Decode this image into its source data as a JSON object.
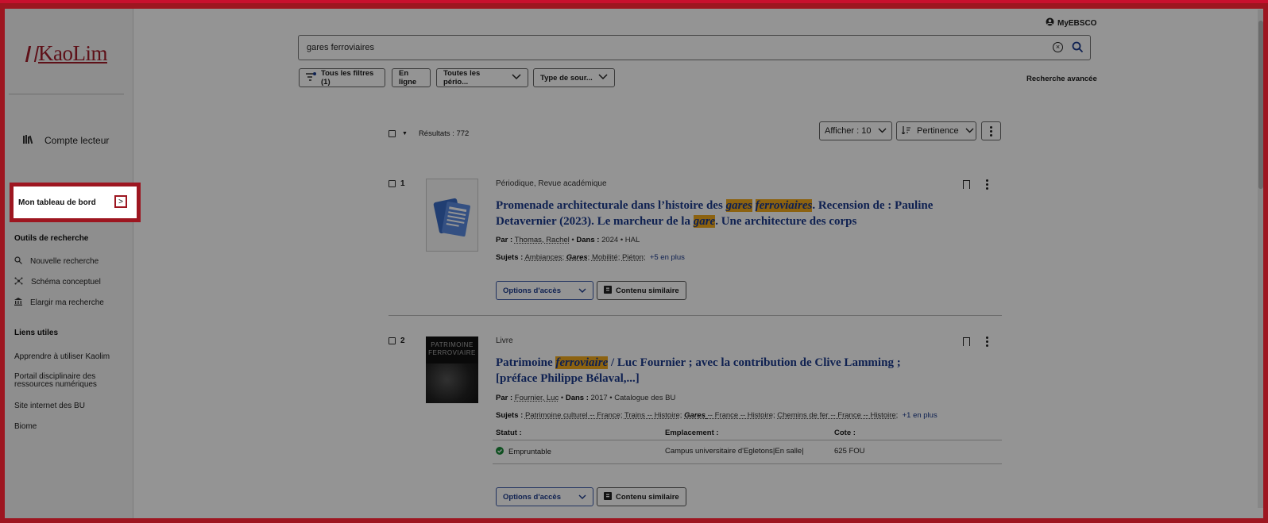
{
  "app": {
    "logo": "KaoLim",
    "account_link": "MyEBSCO"
  },
  "sidebar": {
    "compte": "Compte lecteur",
    "dashboard": "Mon tableau de bord",
    "tools_title": "Outils de recherche",
    "tools": [
      "Nouvelle recherche",
      "Schéma conceptuel",
      "Elargir ma recherche"
    ],
    "links_title": "Liens utiles",
    "links": [
      "Apprendre à utiliser Kaolim",
      "Portail disciplinaire des ressources numériques",
      "Site internet des BU",
      "Biome"
    ]
  },
  "search": {
    "value": "gares ferroviaires"
  },
  "filters": {
    "all": "Tous les filtres (1)",
    "online": "En ligne",
    "periods": "Toutes les pério...",
    "source": "Type de sour...",
    "advanced": "Recherche avancée"
  },
  "results": {
    "count_label": "Résultats : 772",
    "per_page": "Afficher : 10",
    "sort": "Pertinence"
  },
  "items": [
    {
      "num": "1",
      "type": "Périodique, Revue académique",
      "title_parts": [
        "Promenade architecturale dans l’histoire des ",
        "gares",
        " ",
        "ferroviaires",
        ". Recension de : Pauline Detavernier (2023). Le marcheur de la ",
        "gare",
        ". Une architecture des corps"
      ],
      "by_label": "Par :",
      "author": "Thomas, Rachel",
      "in_label": "Dans :",
      "in_value": "2024 • HAL",
      "subjects_label": "Sujets :",
      "subjects": [
        "Ambiances",
        "Gares",
        "Mobilité",
        "Piéton"
      ],
      "more": "+5 en plus",
      "access": "Options d'accès",
      "similar": "Contenu similaire"
    },
    {
      "num": "2",
      "type": "Livre",
      "title_parts": [
        "Patrimoine ",
        "ferroviaire",
        " / Luc Fournier ; avec la contribution de Clive Lamming ; [préface Philippe Bélaval,...]"
      ],
      "by_label": "Par :",
      "author": "Fournier, Luc",
      "in_label": "Dans :",
      "in_value": "2017 • Catalogue des BU",
      "subjects_label": "Sujets :",
      "subjects": [
        "Patrimoine culturel -- France",
        "Trains -- Histoire",
        "Gares",
        "-- France -- Histoire",
        "Chemins de fer -- France -- Histoire"
      ],
      "more": "+1 en plus",
      "cover_text": "PATRIMOINE FERROVIAIRE",
      "status_label": "Statut :",
      "location_label": "Emplacement :",
      "call_label": "Cote :",
      "status": "Empruntable",
      "location": "Campus universitaire d'Egletons|En salle|",
      "call": "625 FOU",
      "access": "Options d'accès",
      "similar": "Contenu similaire"
    }
  ],
  "colors": {
    "brand": "#9d1620",
    "link": "#1b3a8c",
    "highlight": "#f2a91c",
    "available": "#1a8a3a"
  }
}
